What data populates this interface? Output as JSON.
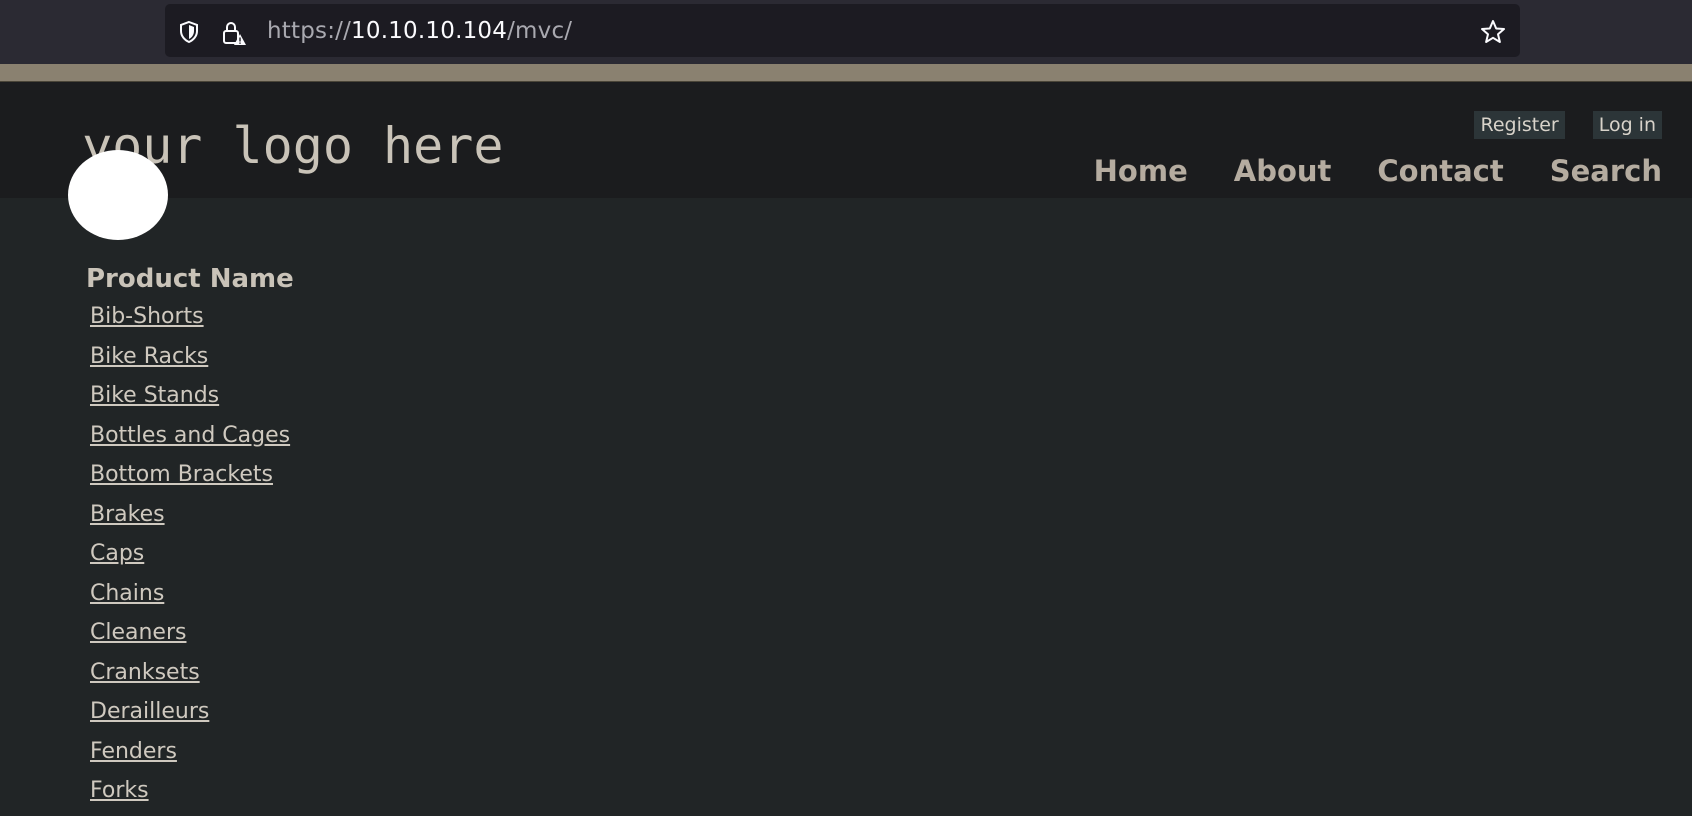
{
  "browser": {
    "url_scheme": "https://",
    "url_host": "10.10.10.104",
    "url_path": "/mvc/",
    "shield_icon": "shield-icon",
    "lock_icon": "lock-warning-icon",
    "star_icon": "star-icon"
  },
  "header": {
    "logo_text": "your logo here",
    "register_label": "Register",
    "login_label": "Log in",
    "nav": {
      "home": "Home",
      "about": "About",
      "contact": "Contact",
      "search": "Search"
    }
  },
  "main": {
    "heading": "Product Name",
    "products": [
      "Bib-Shorts",
      "Bike Racks",
      "Bike Stands",
      "Bottles and Cages",
      "Bottom Brackets",
      "Brakes",
      "Caps",
      "Chains",
      "Cleaners",
      "Cranksets",
      "Derailleurs",
      "Fenders",
      "Forks"
    ]
  },
  "colors": {
    "page_bg": "#212526",
    "header_bg": "#1b1c1e",
    "accent_strip": "#8a8170",
    "nav_text": "#b5aca0"
  }
}
